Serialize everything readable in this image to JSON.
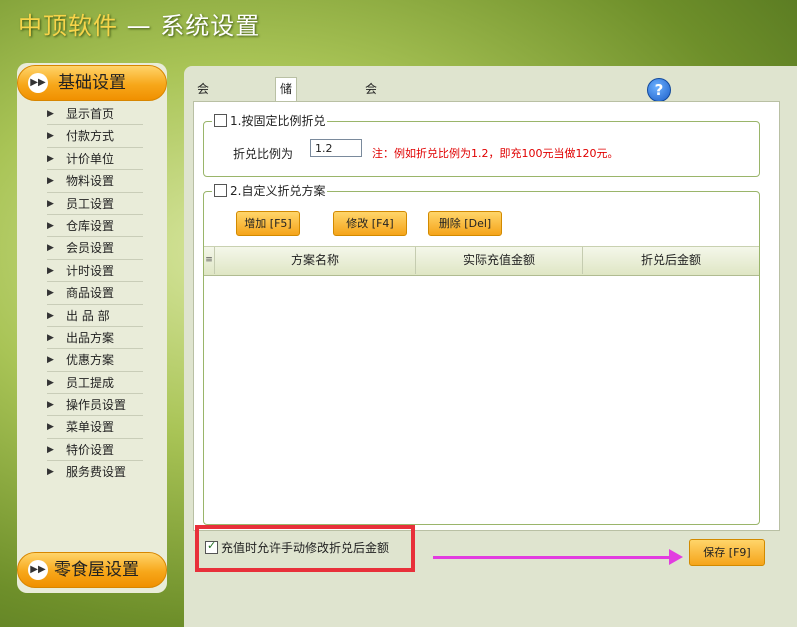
{
  "app": {
    "brand": "中顶软件",
    "title_suffix": " — 系统设置"
  },
  "sidebar": {
    "group_basic": "基础设置",
    "group_snack": "零食屋设置",
    "items": [
      {
        "label": "显示首页"
      },
      {
        "label": "付款方式"
      },
      {
        "label": "计价单位"
      },
      {
        "label": "物料设置"
      },
      {
        "label": "员工设置"
      },
      {
        "label": "仓库设置"
      },
      {
        "label": "会员设置"
      },
      {
        "label": "计时设置"
      },
      {
        "label": "商品设置"
      },
      {
        "label": "出 品 部"
      },
      {
        "label": "出品方案"
      },
      {
        "label": "优惠方案"
      },
      {
        "label": "员工提成"
      },
      {
        "label": "操作员设置"
      },
      {
        "label": "菜单设置"
      },
      {
        "label": "特价设置"
      },
      {
        "label": "服务费设置"
      }
    ]
  },
  "tabs": [
    {
      "label": "会员级别设置"
    },
    {
      "label": "储值折兑设置"
    },
    {
      "label": "会员积分设置"
    }
  ],
  "section_fixed": {
    "title": "1.按固定比例折兑",
    "ratio_label": "折兑比例为",
    "ratio_value": "1.2",
    "note": "注：例如折兑比例为1.2，即充100元当做120元。"
  },
  "section_custom": {
    "title": "2.自定义折兑方案",
    "buttons": {
      "add": "增加 [F5]",
      "edit": "修改 [F4]",
      "delete": "删除 [Del]"
    },
    "columns": [
      "方案名称",
      "实际充值金额",
      "折兑后金额"
    ],
    "rows": []
  },
  "footer": {
    "allow_manual_label": "充值时允许手动修改折兑后金额",
    "allow_manual_checked": true,
    "save_label": "保存 [F9]"
  },
  "colors": {
    "accent_orange": "#f5a41a",
    "highlight_red": "#e8303a",
    "arrow_magenta": "#e23ce0",
    "note_red": "#e00000"
  }
}
